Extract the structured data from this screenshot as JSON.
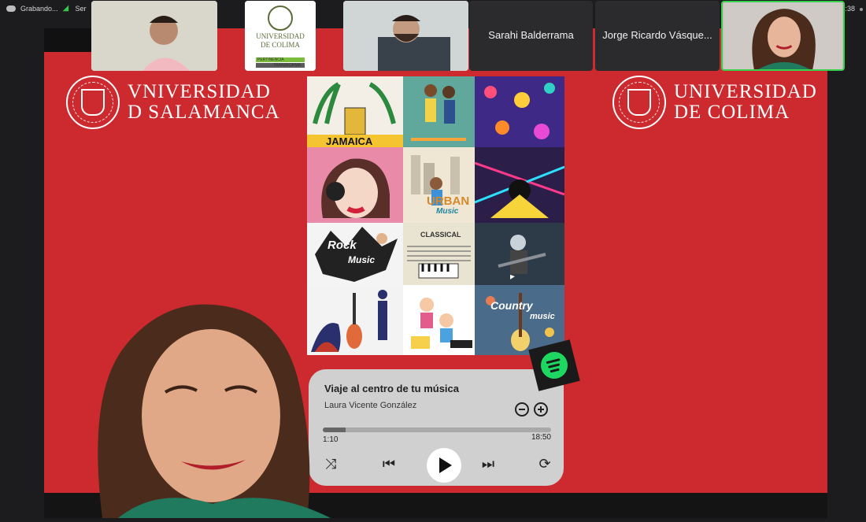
{
  "status": {
    "recording_label": "Grabando...",
    "share_label": "Ser",
    "time_fragment": ":38"
  },
  "participants": [
    {
      "name": "",
      "type": "video"
    },
    {
      "name": "",
      "type": "logo",
      "logo_lines": [
        "UNIVERSIDAD",
        "DE COLIMA"
      ],
      "tag_lines": [
        "PERTINENCIA",
        "TRANSFORMA"
      ]
    },
    {
      "name": "",
      "type": "video"
    },
    {
      "name": "Sarahi Balderrama",
      "type": "name"
    },
    {
      "name": "Jorge Ricardo Vásque...",
      "type": "name"
    },
    {
      "name": "",
      "type": "video",
      "active": true
    }
  ],
  "slide": {
    "left_logo": [
      "VNIVERSIDAD",
      "D SALAMANCA"
    ],
    "right_logo": [
      "UNIVERSIDAD",
      "DE COLIMA"
    ],
    "collage_labels": {
      "jamaica": "JAMAICA",
      "urban": "URBAN",
      "urban_sub": "Music",
      "rock": "Rock",
      "rock_sub": "Music",
      "classical": "CLASSICAL",
      "country": "Country",
      "country_sub": "music"
    }
  },
  "player": {
    "title": "Viaje al centro de tu música",
    "artist": "Laura Vicente González",
    "current_time": "1:10",
    "total_time": "18:50",
    "progress": 0.1,
    "icons": [
      "shuffle-icon",
      "previous-icon",
      "play-icon",
      "next-icon",
      "repeat-icon",
      "minus-icon",
      "plus-icon",
      "spotify-icon"
    ]
  },
  "colors": {
    "slide_red": "#cc2a2e",
    "active_border": "#37d14d",
    "spotify_green": "#1ed760"
  }
}
